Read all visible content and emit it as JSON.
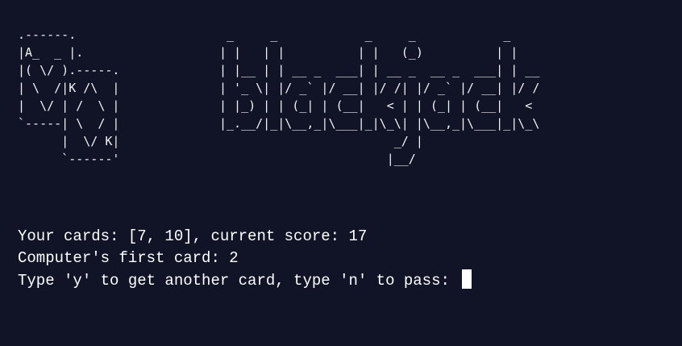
{
  "logo": {
    "cards_art": ".------.\n|A_  _ |.\n|( \\/ ).-----.\n| \\  /|K /\\  |\n|  \\/ | /  \\ |\n`-----| \\  / |\n      |  \\/ K|\n      `------'",
    "title_art": " _     _            _     _            _    \n| |   | |          | |   (_)          | |   \n| |__ | | __ _  ___| | __ _  __ _  ___| | __\n| '_ \\| |/ _` |/ __| |/ /| |/ _` |/ __| |/ /\n| |_) | | (_| | (__|   < | | (_| | (__|   < \n|_.__/|_|\\__,_|\\___|_|\\_\\| |\\__,_|\\___|_|\\_\\\n                        _/ |                \n                       |__/                 "
  },
  "output": {
    "line1": "Your cards: [7, 10], current score: 17",
    "line2": "Computer's first card: 2",
    "prompt": "Type 'y' to get another card, type 'n' to pass: "
  }
}
